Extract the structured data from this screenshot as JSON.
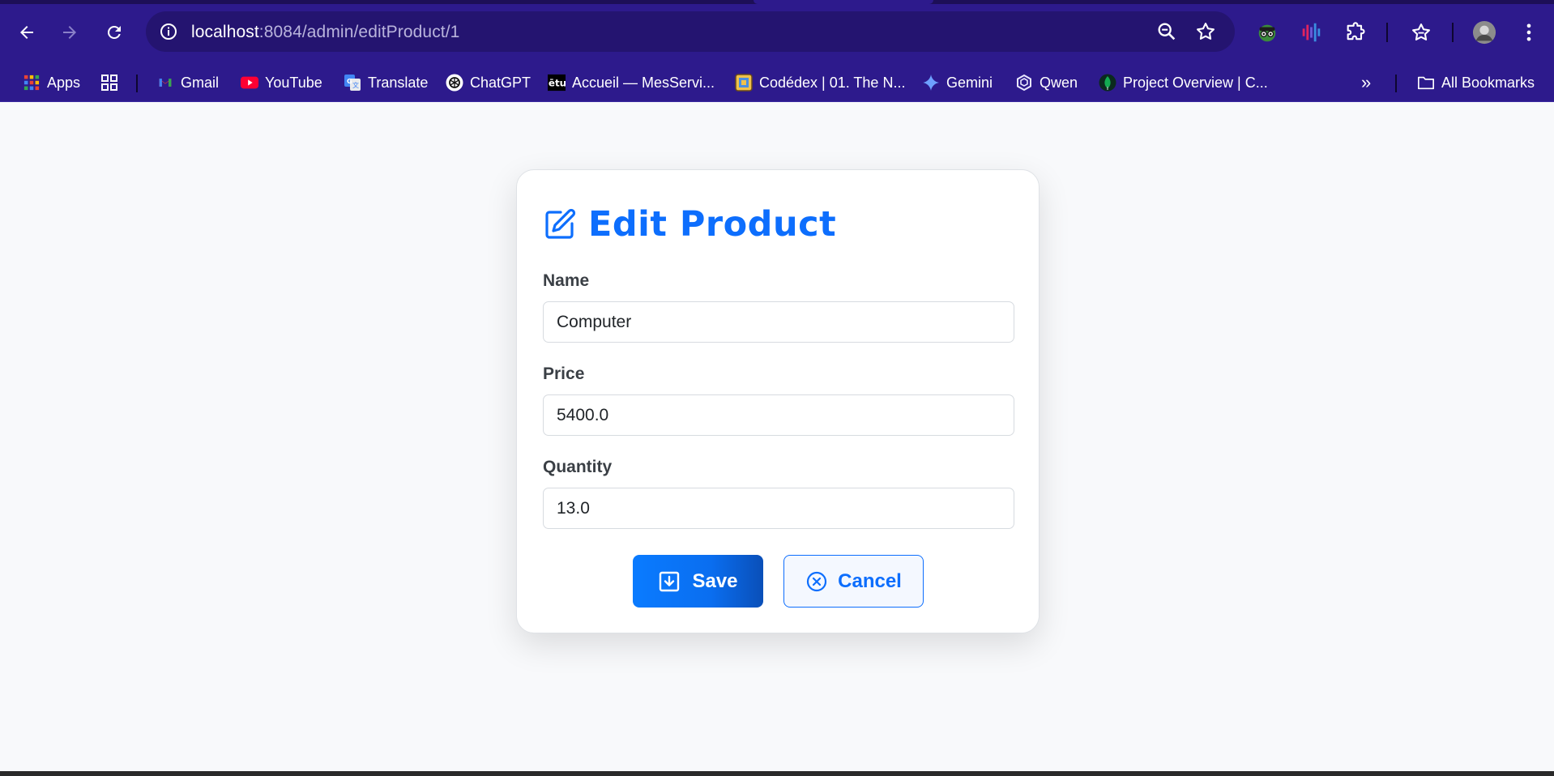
{
  "browser": {
    "url_host": "localhost",
    "url_rest": ":8084/admin/editProduct/1",
    "bookmarks": [
      {
        "label": "Apps",
        "icon": "apps-grid-icon"
      },
      {
        "label": "",
        "icon": "tab-groups-icon"
      },
      {
        "label": "Gmail",
        "icon": "gmail-icon"
      },
      {
        "label": "YouTube",
        "icon": "youtube-icon"
      },
      {
        "label": "Translate",
        "icon": "translate-icon"
      },
      {
        "label": "ChatGPT",
        "icon": "chatgpt-icon"
      },
      {
        "label": "Accueil — MesServi...",
        "icon": "etu-icon"
      },
      {
        "label": "Codédex | 01. The N...",
        "icon": "codedex-icon"
      },
      {
        "label": "Gemini",
        "icon": "gemini-icon"
      },
      {
        "label": "Qwen",
        "icon": "qwen-icon"
      },
      {
        "label": "Project Overview | C...",
        "icon": "mongodb-icon"
      }
    ],
    "all_bookmarks_label": "All Bookmarks",
    "overflow_label": "»"
  },
  "form": {
    "title": "Edit Product",
    "fields": [
      {
        "label": "Name",
        "value": "Computer"
      },
      {
        "label": "Price",
        "value": "5400.0"
      },
      {
        "label": "Quantity",
        "value": "13.0"
      }
    ],
    "save_label": "Save",
    "cancel_label": "Cancel"
  },
  "colors": {
    "chrome": "#2d1a8c",
    "omnibox": "#241470",
    "primary": "#0d6efd",
    "page_bg": "#f8f9fb"
  }
}
